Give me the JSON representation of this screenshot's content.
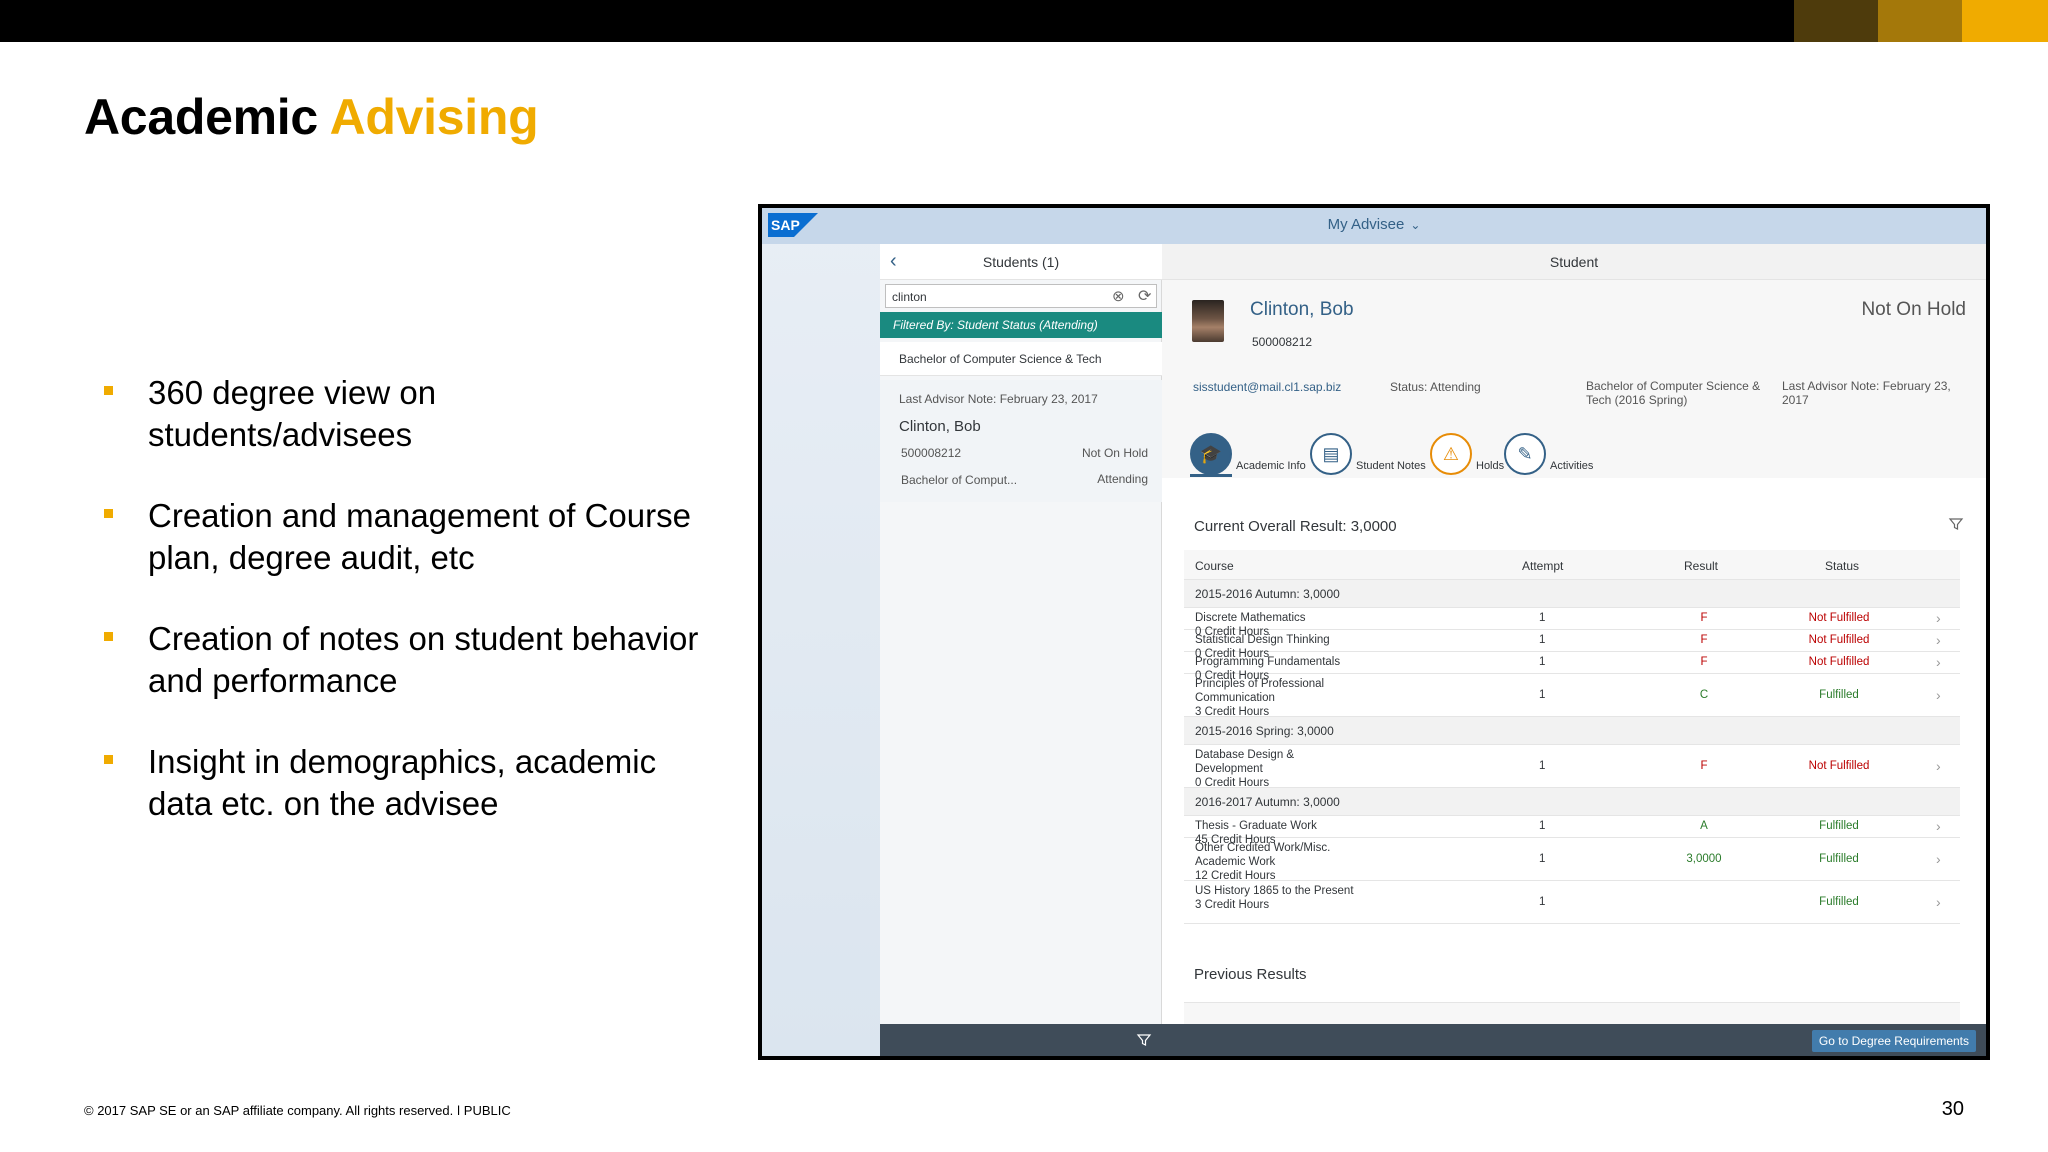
{
  "slide": {
    "title_main": "Academic ",
    "title_accent": "Advising",
    "band_colors": [
      "#4e3b0c",
      "#a4780a",
      "#f0ab00"
    ],
    "bullets": [
      "360 degree view on students/advisees",
      "Creation and management of Course plan, degree audit, etc",
      "Creation of notes on student behavior and performance",
      "Insight in demographics, academic data etc. on the advisee"
    ],
    "footer": "© 2017 SAP SE or an SAP affiliate company. All rights reserved.   ǀ   PUBLIC",
    "page_number": "30"
  },
  "app": {
    "logo_text": "SAP",
    "shell_title": "My Advisee",
    "master": {
      "title": "Students (1)",
      "search_value": "clinton",
      "filter_text": "Filtered By: Student Status (Attending)",
      "program_item": "Bachelor of Computer Science & Tech",
      "student": {
        "note": "Last Advisor Note: February 23, 2017",
        "name": "Clinton, Bob",
        "id": "500008212",
        "hold": "Not On Hold",
        "program": "Bachelor of Comput...",
        "status": "Attending"
      }
    },
    "detail": {
      "title": "Student",
      "name": "Clinton, Bob",
      "id": "500008212",
      "hold": "Not On Hold",
      "email": "sisstudent@mail.cl1.sap.biz",
      "status": "Status: Attending",
      "program": "Bachelor of Computer Science & Tech (2016 Spring)",
      "advisor_note": "Last Advisor Note: February 23, 2017",
      "tabs": [
        "Academic Info",
        "Student Notes",
        "Holds",
        "Activities"
      ],
      "overall": "Current Overall Result: 3,0000",
      "columns": [
        "Course",
        "Attempt",
        "Result",
        "Status"
      ],
      "groups": [
        {
          "label": "2015-2016 Autumn: 3,0000",
          "courses": [
            {
              "name": "Discrete Mathematics\n0 Credit Hours",
              "attempt": "1",
              "result": "F",
              "status": "Not Fulfilled",
              "ok": false,
              "h": 22
            },
            {
              "name": "Statistical Design Thinking\n0 Credit Hours",
              "attempt": "1",
              "result": "F",
              "status": "Not Fulfilled",
              "ok": false,
              "h": 22
            },
            {
              "name": "Programming Fundamentals\n0 Credit Hours",
              "attempt": "1",
              "result": "F",
              "status": "Not Fulfilled",
              "ok": false,
              "h": 22
            },
            {
              "name": "Principles of Professional Communication\n3 Credit Hours",
              "attempt": "1",
              "result": "C",
              "status": "Fulfilled",
              "ok": true,
              "h": 43
            }
          ]
        },
        {
          "label": "2015-2016 Spring: 3,0000",
          "courses": [
            {
              "name": "Database Design & Development\n0 Credit Hours",
              "attempt": "1",
              "result": "F",
              "status": "Not Fulfilled",
              "ok": false,
              "h": 43
            }
          ]
        },
        {
          "label": "2016-2017 Autumn: 3,0000",
          "courses": [
            {
              "name": "Thesis - Graduate Work\n45 Credit Hours",
              "attempt": "1",
              "result": "A",
              "status": "Fulfilled",
              "ok": true,
              "h": 22
            },
            {
              "name": "Other Credited Work/Misc. Academic Work\n12 Credit Hours",
              "attempt": "1",
              "result": "3,0000",
              "status": "Fulfilled",
              "ok": true,
              "h": 43
            },
            {
              "name": "US History 1865 to the Present\n3 Credit Hours",
              "attempt": "1",
              "result": "",
              "status": "Fulfilled",
              "ok": true,
              "h": 43
            }
          ]
        }
      ],
      "previous_results": "Previous Results",
      "button": "Go to Degree Requirements"
    }
  }
}
